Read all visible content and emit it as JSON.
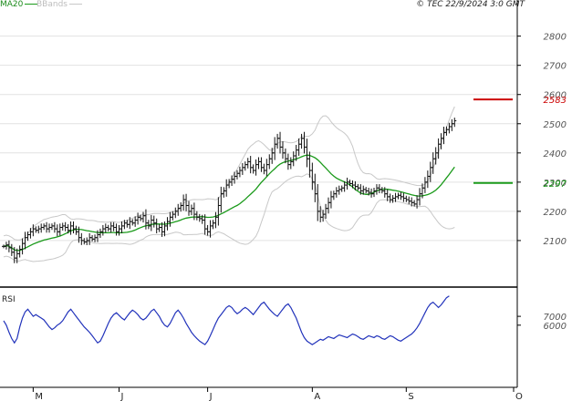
{
  "header": {
    "ma_legend": "MA20",
    "bb_legend": "BBands",
    "copyright": "© TEC 22/9/2024 3:0 GMT"
  },
  "colors": {
    "price": "#111111",
    "ma": "#1a9a1a",
    "bands": "#c8c8c8",
    "rsi": "#2233bb",
    "resistance": "#cc0000",
    "support": "#1a9a1a",
    "grid": "#e2e2e2"
  },
  "chart_data": [
    {
      "type": "ohlc",
      "axis_side": "right",
      "ylim": [
        1950,
        2880
      ],
      "yticks": [
        2100,
        2200,
        2300,
        2400,
        2500,
        2600,
        2700,
        2800
      ],
      "ytick_labels": [
        "2100",
        "2200",
        "2300",
        "2400",
        "2500",
        "2600",
        "2700",
        "2800"
      ],
      "xticks": [
        {
          "label": "M",
          "index": 11
        },
        {
          "label": "J",
          "index": 43
        },
        {
          "label": "J",
          "index": 76
        },
        {
          "label": "A",
          "index": 115
        },
        {
          "label": "S",
          "index": 150
        },
        {
          "label": "O",
          "index": 190
        }
      ],
      "levels": [
        {
          "name": "resistance",
          "value": 2583,
          "label": "2583",
          "color": "#cc0000"
        },
        {
          "name": "support",
          "value": 2297,
          "label": "2297",
          "color": "#1a9a1a"
        }
      ],
      "close": [
        2080,
        2085,
        2075,
        2060,
        2040,
        2055,
        2070,
        2090,
        2110,
        2120,
        2130,
        2140,
        2135,
        2140,
        2145,
        2150,
        2140,
        2145,
        2150,
        2140,
        2130,
        2145,
        2150,
        2145,
        2135,
        2150,
        2140,
        2130,
        2110,
        2100,
        2095,
        2100,
        2110,
        2105,
        2110,
        2120,
        2130,
        2140,
        2145,
        2140,
        2150,
        2145,
        2130,
        2140,
        2150,
        2160,
        2155,
        2165,
        2160,
        2170,
        2180,
        2175,
        2185,
        2160,
        2150,
        2170,
        2160,
        2140,
        2145,
        2130,
        2150,
        2165,
        2180,
        2190,
        2200,
        2210,
        2220,
        2240,
        2220,
        2200,
        2210,
        2190,
        2180,
        2175,
        2170,
        2140,
        2130,
        2150,
        2160,
        2180,
        2220,
        2260,
        2270,
        2290,
        2300,
        2310,
        2320,
        2330,
        2340,
        2350,
        2360,
        2370,
        2350,
        2340,
        2360,
        2370,
        2350,
        2340,
        2360,
        2380,
        2400,
        2430,
        2450,
        2420,
        2400,
        2380,
        2360,
        2370,
        2390,
        2410,
        2430,
        2450,
        2420,
        2380,
        2340,
        2300,
        2260,
        2200,
        2180,
        2190,
        2210,
        2230,
        2250,
        2260,
        2270,
        2275,
        2280,
        2290,
        2300,
        2295,
        2290,
        2285,
        2280,
        2270,
        2275,
        2270,
        2265,
        2260,
        2270,
        2280,
        2275,
        2270,
        2260,
        2250,
        2240,
        2245,
        2250,
        2255,
        2250,
        2245,
        2240,
        2235,
        2230,
        2225,
        2240,
        2260,
        2280,
        2300,
        2320,
        2350,
        2380,
        2400,
        2430,
        2450,
        2470,
        2480,
        2490,
        2500,
        2510
      ]
    },
    {
      "type": "line",
      "title": "RSI",
      "axis_side": "right",
      "ylim": [
        0,
        100
      ],
      "yticks": [
        70,
        60
      ],
      "ytick_labels": [
        "7000",
        "6000"
      ],
      "values": [
        65,
        60,
        52,
        45,
        40,
        45,
        58,
        68,
        75,
        78,
        74,
        70,
        72,
        70,
        68,
        66,
        62,
        58,
        55,
        57,
        60,
        62,
        65,
        70,
        75,
        78,
        74,
        70,
        66,
        62,
        58,
        55,
        52,
        48,
        44,
        40,
        42,
        48,
        55,
        62,
        68,
        72,
        74,
        71,
        68,
        66,
        70,
        74,
        77,
        75,
        72,
        68,
        66,
        68,
        72,
        76,
        78,
        74,
        70,
        64,
        60,
        58,
        62,
        68,
        74,
        77,
        73,
        68,
        62,
        57,
        52,
        48,
        45,
        42,
        40,
        38,
        42,
        48,
        55,
        62,
        68,
        72,
        76,
        80,
        82,
        80,
        76,
        73,
        75,
        78,
        80,
        78,
        75,
        72,
        76,
        80,
        84,
        86,
        82,
        78,
        75,
        72,
        70,
        74,
        78,
        82,
        84,
        80,
        74,
        68,
        60,
        52,
        46,
        42,
        40,
        38,
        40,
        42,
        44,
        43,
        45,
        47,
        46,
        45,
        47,
        49,
        48,
        47,
        46,
        48,
        50,
        49,
        47,
        45,
        44,
        46,
        48,
        47,
        46,
        48,
        47,
        45,
        44,
        46,
        48,
        47,
        45,
        43,
        42,
        44,
        46,
        48,
        50,
        53,
        57,
        62,
        68,
        74,
        80,
        84,
        86,
        83,
        80,
        83,
        87,
        91,
        93
      ]
    }
  ]
}
